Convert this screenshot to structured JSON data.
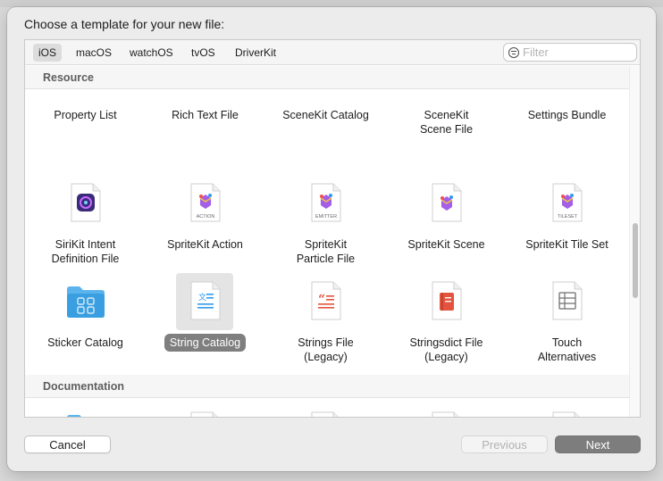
{
  "dialog": {
    "title": "Choose a template for your new file:"
  },
  "tabs": [
    {
      "label": "iOS",
      "active": true
    },
    {
      "label": "macOS",
      "active": false
    },
    {
      "label": "watchOS",
      "active": false
    },
    {
      "label": "tvOS",
      "active": false
    },
    {
      "label": "DriverKit",
      "active": false
    }
  ],
  "filter": {
    "placeholder": "Filter",
    "value": ""
  },
  "sections": {
    "resource": "Resource",
    "documentation": "Documentation"
  },
  "resource_items": {
    "row1": [
      {
        "label": "Property List"
      },
      {
        "label": "Rich Text File"
      },
      {
        "label": "SceneKit Catalog"
      },
      {
        "label": "SceneKit\nScene File"
      },
      {
        "label": "Settings Bundle"
      }
    ],
    "row2": [
      {
        "label": "SiriKit Intent\nDefinition File",
        "icon": "sirikit-intent-icon"
      },
      {
        "label": "SpriteKit Action",
        "icon": "spritekit-action-icon",
        "badge": "ACTION"
      },
      {
        "label": "SpriteKit\nParticle File",
        "icon": "spritekit-emitter-icon",
        "badge": "EMITTER"
      },
      {
        "label": "SpriteKit Scene",
        "icon": "spritekit-scene-icon"
      },
      {
        "label": "SpriteKit Tile Set",
        "icon": "spritekit-tileset-icon",
        "badge": "TILESET"
      }
    ],
    "row3": [
      {
        "label": "Sticker Catalog",
        "icon": "sticker-folder-icon"
      },
      {
        "label": "String Catalog",
        "icon": "string-catalog-icon",
        "selected": true
      },
      {
        "label": "Strings File\n(Legacy)",
        "icon": "strings-file-icon"
      },
      {
        "label": "Stringsdict File\n(Legacy)",
        "icon": "stringsdict-file-icon"
      },
      {
        "label": "Touch\nAlternatives",
        "icon": "touch-alternatives-icon"
      }
    ]
  },
  "documentation_icons": [
    "documentation-folder-icon",
    "article-doc-icon",
    "list-doc-icon",
    "tutorial-doc-icon",
    "tutorial-table-icon"
  ],
  "buttons": {
    "cancel": "Cancel",
    "previous": "Previous",
    "next": "Next"
  },
  "colors": {
    "selection": "#7f7f7f",
    "folder_blue": "#3a9fe0",
    "doc_blue": "#2f7fe6",
    "strings_red": "#e3533d"
  }
}
